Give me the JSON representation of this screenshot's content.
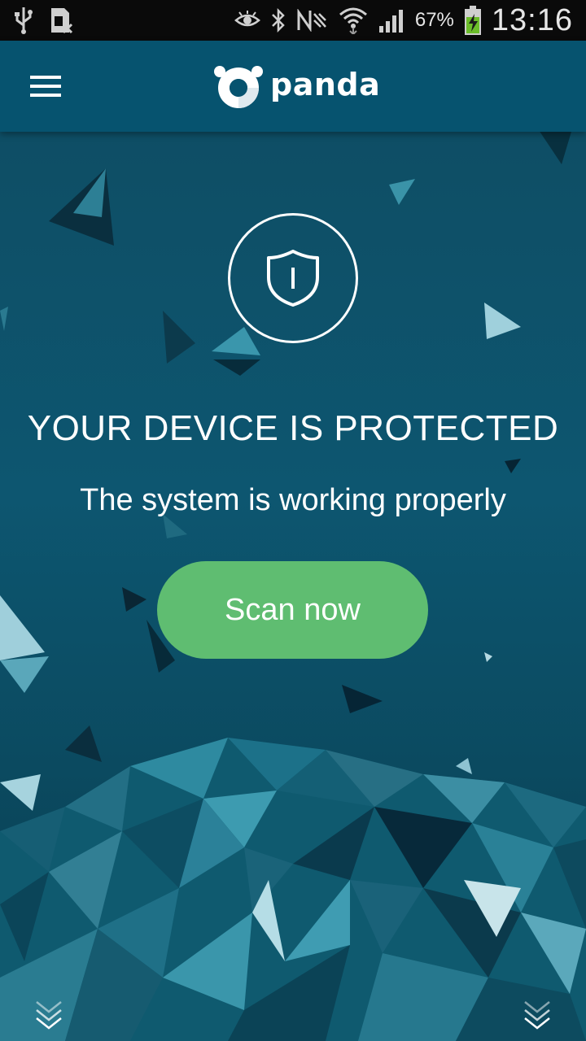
{
  "status_bar": {
    "battery_percent": "67%",
    "time": "13:16",
    "icons": [
      "usb-icon",
      "sim-icon",
      "eye-icon",
      "bluetooth-icon",
      "nfc-icon",
      "wifi-icon",
      "signal-icon",
      "battery-charging-icon"
    ]
  },
  "app_bar": {
    "logo_text": "panda",
    "menu_icon": "hamburger-menu-icon"
  },
  "main": {
    "status_icon": "shield-icon",
    "headline": "YOUR DEVICE IS PROTECTED",
    "subline": "The system is working properly",
    "scan_button_label": "Scan now"
  },
  "colors": {
    "app_bar": "#06536f",
    "background": "#0d5670",
    "accent_green": "#5fbd71",
    "status_bar": "#0a0a0a"
  }
}
